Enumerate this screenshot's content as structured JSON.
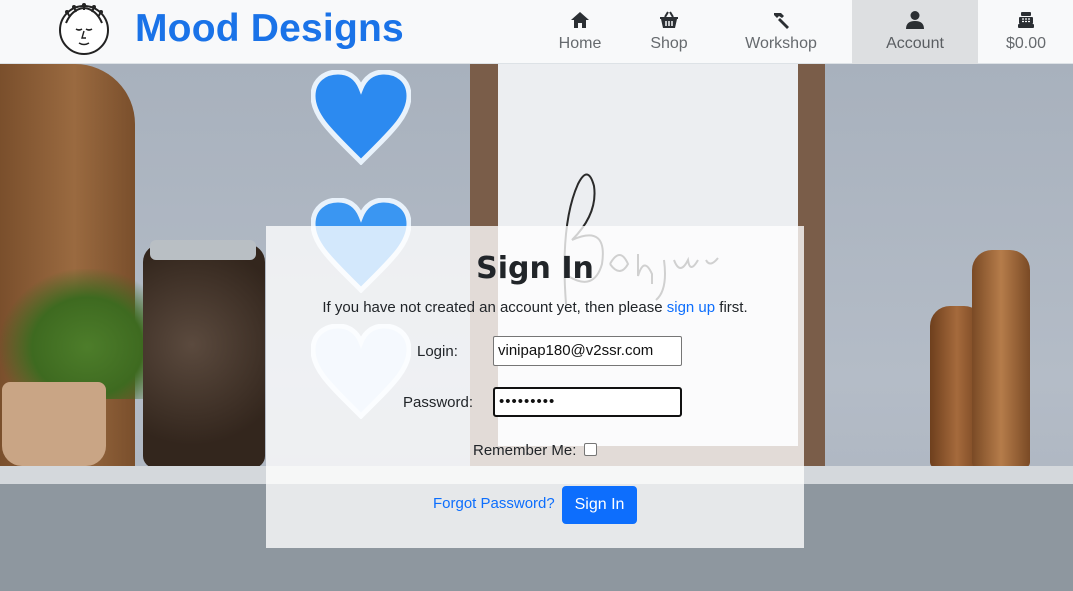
{
  "brand": {
    "name": "Mood Designs",
    "color": "#1a73e8",
    "logo_icon": "face-logo-icon"
  },
  "nav": {
    "items": [
      {
        "label": "Home",
        "icon": "home-icon"
      },
      {
        "label": "Shop",
        "icon": "basket-icon"
      },
      {
        "label": "Workshop",
        "icon": "hammer-icon"
      },
      {
        "label": "Account",
        "icon": "user-icon",
        "active": true
      },
      {
        "label": "$0.00",
        "icon": "cash-register-icon"
      }
    ]
  },
  "signin": {
    "title": "Sign In",
    "intro_before": "If you have not created an account yet, then please",
    "intro_link": "sign up",
    "intro_after": "first.",
    "login_label": "Login:",
    "login_value": "vinipap180@v2ssr.com",
    "password_label": "Password:",
    "password_value": "•••••••••",
    "remember_label": "Remember Me:",
    "remember_checked": false,
    "forgot_label": "Forgot Password?",
    "submit_label": "Sign In"
  },
  "colors": {
    "link": "#0d6efd",
    "button": "#0d6efd",
    "active_nav_bg": "#dddfe1"
  }
}
